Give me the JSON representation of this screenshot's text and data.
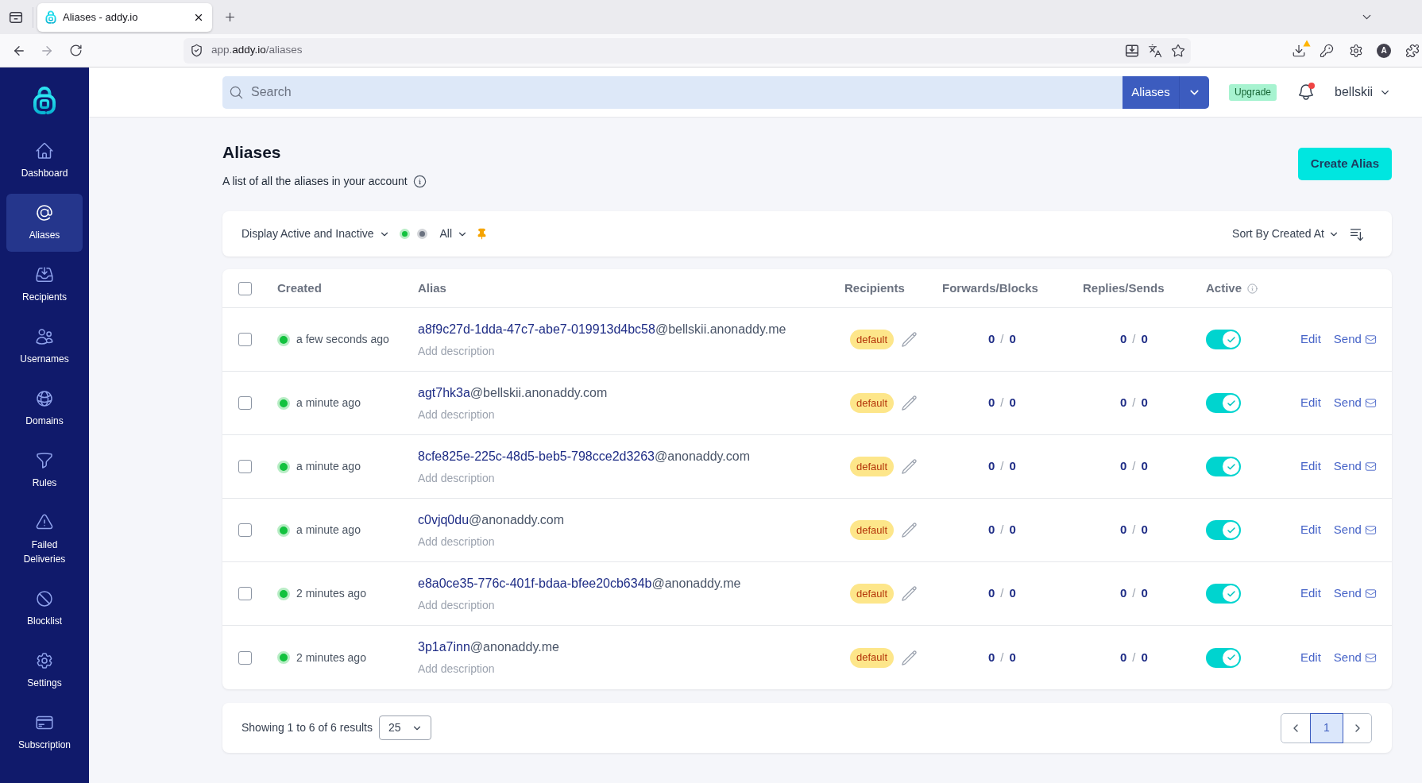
{
  "browser": {
    "tab": {
      "title": "Aliases - addy.io",
      "selected": true
    },
    "url": {
      "subdomain": "app.",
      "domain": "addy.io",
      "path": "/aliases"
    },
    "profile_initial": "A"
  },
  "sidebar": {
    "items": [
      {
        "label": "Dashboard",
        "selected": false
      },
      {
        "label": "Aliases",
        "selected": true
      },
      {
        "label": "Recipients",
        "selected": false
      },
      {
        "label": "Usernames",
        "selected": false
      },
      {
        "label": "Domains",
        "selected": false
      },
      {
        "label": "Rules",
        "selected": false
      },
      {
        "label": "Failed Deliveries",
        "selected": false
      },
      {
        "label": "Blocklist",
        "selected": false
      },
      {
        "label": "Settings",
        "selected": false
      },
      {
        "label": "Subscription",
        "selected": false
      }
    ]
  },
  "header": {
    "search": {
      "placeholder": "Search"
    },
    "scope": "Aliases",
    "upgrade": "Upgrade",
    "notifications": {
      "unread": true
    },
    "user": "bellskii"
  },
  "page": {
    "title": "Aliases",
    "subtitle": "A list of all the aliases in your account",
    "create_button": "Create Alias"
  },
  "filters": {
    "display": "Display Active and Inactive",
    "status_dots": [
      {
        "color": "#12c23e"
      },
      {
        "color": "#6b7280"
      }
    ],
    "type": "All",
    "sort": "Sort By Created At"
  },
  "table": {
    "select_all": {
      "checked": false
    },
    "columns": [
      "Created",
      "Alias",
      "Recipients",
      "Forwards/Blocks",
      "Replies/Sends",
      "Active"
    ],
    "rows": [
      {
        "checked": false,
        "active": true,
        "created": "a few seconds ago",
        "local_part": "a8f9c27d-1dda-47c7-abe7-019913d4bc58",
        "domain": "@bellskii.anonaddy.me",
        "add_description": "Add description",
        "recipient": "default",
        "forwards_blocks": {
          "forwards": "0",
          "separator": "/",
          "blocks": "0"
        },
        "replies_sends": {
          "replies": "0",
          "separator": "/",
          "sends": "0"
        },
        "edit": "Edit",
        "send": "Send"
      },
      {
        "checked": false,
        "active": true,
        "created": "a minute ago",
        "local_part": "agt7hk3a",
        "domain": "@bellskii.anonaddy.com",
        "add_description": "Add description",
        "recipient": "default",
        "forwards_blocks": {
          "forwards": "0",
          "separator": "/",
          "blocks": "0"
        },
        "replies_sends": {
          "replies": "0",
          "separator": "/",
          "sends": "0"
        },
        "edit": "Edit",
        "send": "Send"
      },
      {
        "checked": false,
        "active": true,
        "created": "a minute ago",
        "local_part": "8cfe825e-225c-48d5-beb5-798cce2d3263",
        "domain": "@anonaddy.com",
        "add_description": "Add description",
        "recipient": "default",
        "forwards_blocks": {
          "forwards": "0",
          "separator": "/",
          "blocks": "0"
        },
        "replies_sends": {
          "replies": "0",
          "separator": "/",
          "sends": "0"
        },
        "edit": "Edit",
        "send": "Send"
      },
      {
        "checked": false,
        "active": true,
        "created": "a minute ago",
        "local_part": "c0vjq0du",
        "domain": "@anonaddy.com",
        "add_description": "Add description",
        "recipient": "default",
        "forwards_blocks": {
          "forwards": "0",
          "separator": "/",
          "blocks": "0"
        },
        "replies_sends": {
          "replies": "0",
          "separator": "/",
          "sends": "0"
        },
        "edit": "Edit",
        "send": "Send"
      },
      {
        "checked": false,
        "active": true,
        "created": "2 minutes ago",
        "local_part": "e8a0ce35-776c-401f-bdaa-bfee20cb634b",
        "domain": "@anonaddy.me",
        "add_description": "Add description",
        "recipient": "default",
        "forwards_blocks": {
          "forwards": "0",
          "separator": "/",
          "blocks": "0"
        },
        "replies_sends": {
          "replies": "0",
          "separator": "/",
          "sends": "0"
        },
        "edit": "Edit",
        "send": "Send"
      },
      {
        "checked": false,
        "active": true,
        "created": "2 minutes ago",
        "local_part": "3p1a7inn",
        "domain": "@anonaddy.me",
        "add_description": "Add description",
        "recipient": "default",
        "forwards_blocks": {
          "forwards": "0",
          "separator": "/",
          "blocks": "0"
        },
        "replies_sends": {
          "replies": "0",
          "separator": "/",
          "sends": "0"
        },
        "edit": "Edit",
        "send": "Send"
      }
    ]
  },
  "pagination": {
    "summary": "Showing 1 to 6 of 6 results",
    "per_page": "25",
    "pages": [
      {
        "label": "1",
        "selected": true
      }
    ]
  }
}
